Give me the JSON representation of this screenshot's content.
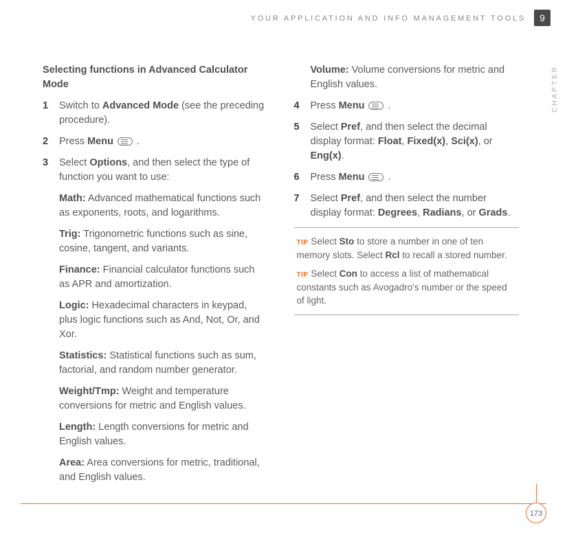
{
  "running_head": "YOUR APPLICATION AND INFO MANAGEMENT TOOLS",
  "chapter_number": "9",
  "chapter_label": "CHAPTER",
  "page_number": "173",
  "section_title": "Selecting functions in Advanced Calculator Mode",
  "steps": {
    "s1": {
      "n": "1",
      "pre": "Switch to ",
      "b1": "Advanced Mode",
      "post": " (see the preceding procedure)."
    },
    "s2": {
      "n": "2",
      "pre": "Press ",
      "b1": "Menu",
      "post": " ."
    },
    "s3": {
      "n": "3",
      "pre": "Select ",
      "b1": "Options",
      "post": ", and then select the type of function you want to use:"
    },
    "s4": {
      "n": "4",
      "pre": "Press ",
      "b1": "Menu",
      "post": " ."
    },
    "s5": {
      "n": "5",
      "pre": "Select ",
      "b1": "Pref",
      "mid1": ", and then select the decimal display format: ",
      "b2": "Float",
      "sep1": ", ",
      "b3": "Fixed(x)",
      "sep2": ", ",
      "b4": "Sci(x)",
      "sep3": ", or ",
      "b5": "Eng(x)",
      "post": "."
    },
    "s6": {
      "n": "6",
      "pre": "Press ",
      "b1": "Menu",
      "post": " ."
    },
    "s7": {
      "n": "7",
      "pre": "Select ",
      "b1": "Pref",
      "mid1": ", and then select the number display format: ",
      "b2": "Degrees",
      "sep1": ", ",
      "b3": "Radians",
      "sep2": ", or ",
      "b4": "Grads",
      "post": "."
    }
  },
  "defs": {
    "math": {
      "label": "Math:",
      "text": " Advanced mathematical functions such as exponents, roots, and logarithms."
    },
    "trig": {
      "label": "Trig:",
      "text": " Trigonometric functions such as sine, cosine, tangent, and variants."
    },
    "finance": {
      "label": "Finance:",
      "text": " Financial calculator functions such as APR and amortization."
    },
    "logic": {
      "label": "Logic:",
      "text": " Hexadecimal characters in keypad, plus logic functions such as And, Not, Or, and Xor."
    },
    "statistics": {
      "label": "Statistics:",
      "text": " Statistical functions such as sum, factorial, and random number generator."
    },
    "weight": {
      "label": "Weight/Tmp:",
      "text": " Weight and temperature conversions for metric and English values."
    },
    "length": {
      "label": "Length:",
      "text": " Length conversions for metric and English values."
    },
    "area": {
      "label": "Area:",
      "text": " Area conversions for metric, traditional, and English values."
    },
    "volume": {
      "label": "Volume:",
      "text": " Volume conversions for metric and English values."
    }
  },
  "tips": {
    "label": "TIP",
    "t1": {
      "pre": " Select ",
      "b1": "Sto",
      "mid": " to store a number in one of ten memory slots. Select ",
      "b2": "Rcl",
      "post": " to recall a stored number."
    },
    "t2": {
      "pre": " Select ",
      "b1": "Con",
      "post": " to access a list of mathematical constants such as Avogadro's number or the speed of light."
    }
  }
}
